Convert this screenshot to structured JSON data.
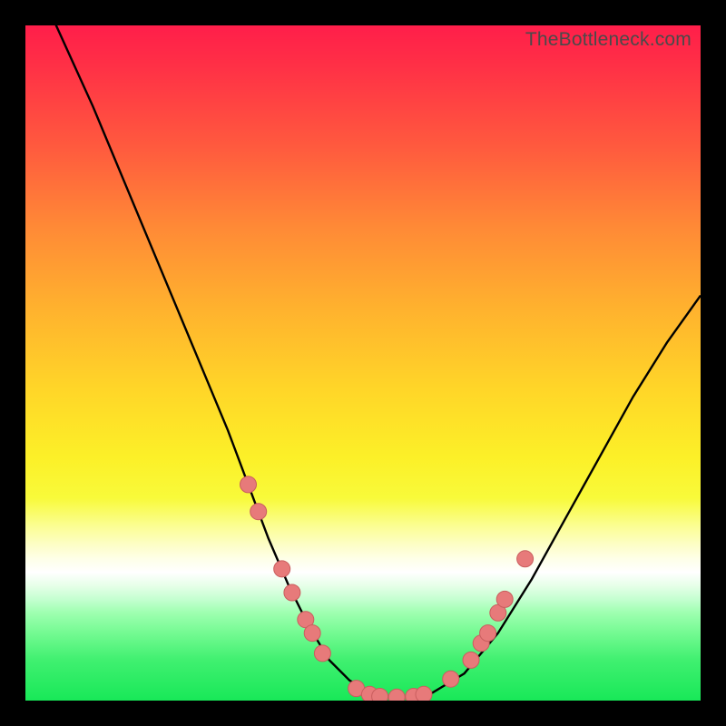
{
  "watermark": "TheBottleneck.com",
  "colors": {
    "curve": "#000000",
    "marker_fill": "#e77a7a",
    "marker_stroke": "#c95e5e"
  },
  "chart_data": {
    "type": "line",
    "title": "",
    "xlabel": "",
    "ylabel": "",
    "xlim": [
      0,
      100
    ],
    "ylim": [
      0,
      100
    ],
    "series": [
      {
        "name": "bottleneck-curve",
        "x": [
          0,
          5,
          10,
          15,
          20,
          25,
          30,
          33,
          36,
          39,
          42,
          45,
          48,
          51,
          54,
          57,
          60,
          65,
          70,
          75,
          80,
          85,
          90,
          95,
          100
        ],
        "y": [
          110,
          99,
          88,
          76,
          64,
          52,
          40,
          32,
          24,
          17,
          11,
          6,
          3,
          1.2,
          0.5,
          0.5,
          1,
          4,
          10,
          18,
          27,
          36,
          45,
          53,
          60
        ]
      }
    ],
    "markers": {
      "name": "highlighted-points",
      "points": [
        {
          "x": 33,
          "y": 32
        },
        {
          "x": 34.5,
          "y": 28
        },
        {
          "x": 38,
          "y": 19.5
        },
        {
          "x": 39.5,
          "y": 16
        },
        {
          "x": 41.5,
          "y": 12
        },
        {
          "x": 42.5,
          "y": 10
        },
        {
          "x": 44,
          "y": 7
        },
        {
          "x": 49,
          "y": 1.8
        },
        {
          "x": 51,
          "y": 0.9
        },
        {
          "x": 52.5,
          "y": 0.6
        },
        {
          "x": 55,
          "y": 0.5
        },
        {
          "x": 57.5,
          "y": 0.6
        },
        {
          "x": 59,
          "y": 0.9
        },
        {
          "x": 63,
          "y": 3.2
        },
        {
          "x": 66,
          "y": 6
        },
        {
          "x": 67.5,
          "y": 8.5
        },
        {
          "x": 68.5,
          "y": 10
        },
        {
          "x": 70,
          "y": 13
        },
        {
          "x": 71,
          "y": 15
        },
        {
          "x": 74,
          "y": 21
        }
      ]
    }
  }
}
